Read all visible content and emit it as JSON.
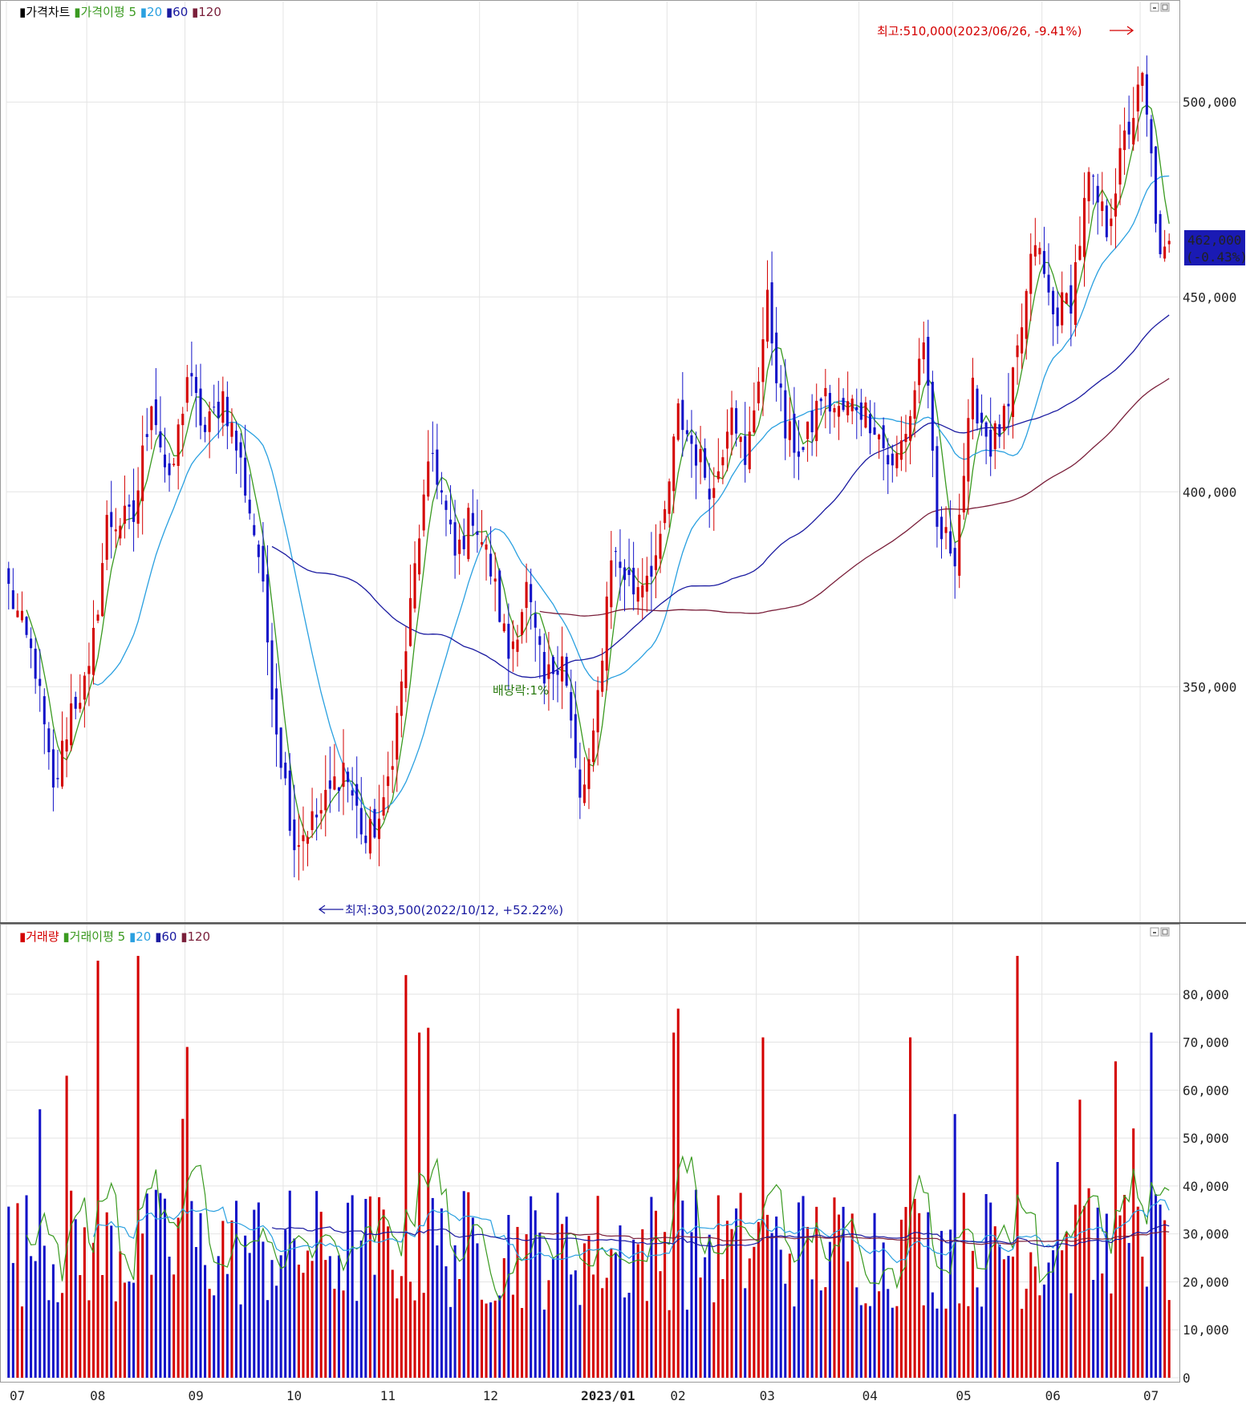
{
  "price_panel": {
    "legend": [
      {
        "text": "가격차트",
        "color": "#000000"
      },
      {
        "text": "가격이평",
        "color": "#3a9a20"
      },
      {
        "text": "5",
        "color": "#3a9a20"
      },
      {
        "text": "20",
        "color": "#2aa0e0"
      },
      {
        "text": "60",
        "color": "#1a1aa0"
      },
      {
        "text": "120",
        "color": "#7a1f3a"
      }
    ],
    "high_annotation": "최고:510,000(2023/06/26, -9.41%)",
    "low_annotation": "최저:303,500(2022/10/12, +52.22%)",
    "dividend_annotation": "배당락:1%",
    "current_price": "462,000",
    "current_change": "(-0.43%)",
    "y_ticks": [
      {
        "value": 500000,
        "label": "500,000"
      },
      {
        "value": 450000,
        "label": "450,000"
      },
      {
        "value": 400000,
        "label": "400,000"
      },
      {
        "value": 350000,
        "label": "350,000"
      }
    ]
  },
  "volume_panel": {
    "legend": [
      {
        "text": "거래량",
        "color": "#d40000"
      },
      {
        "text": "거래이평",
        "color": "#3a9a20"
      },
      {
        "text": "5",
        "color": "#3a9a20"
      },
      {
        "text": "20",
        "color": "#2aa0e0"
      },
      {
        "text": "60",
        "color": "#1a1aa0"
      },
      {
        "text": "120",
        "color": "#7a1f3a"
      }
    ],
    "y_ticks": [
      {
        "value": 80000,
        "label": "80,000"
      },
      {
        "value": 70000,
        "label": "70,000"
      },
      {
        "value": 60000,
        "label": "60,000"
      },
      {
        "value": 50000,
        "label": "50,000"
      },
      {
        "value": 40000,
        "label": "40,000"
      },
      {
        "value": 30000,
        "label": "30,000"
      },
      {
        "value": 20000,
        "label": "20,000"
      },
      {
        "value": 10000,
        "label": "10,000"
      },
      {
        "value": 0,
        "label": "0"
      }
    ]
  },
  "x_labels": [
    {
      "label": "07",
      "bold": false
    },
    {
      "label": "08",
      "bold": false
    },
    {
      "label": "09",
      "bold": false
    },
    {
      "label": "10",
      "bold": false
    },
    {
      "label": "11",
      "bold": false
    },
    {
      "label": "12",
      "bold": false
    },
    {
      "label": "2023/01",
      "bold": true
    },
    {
      "label": "02",
      "bold": false
    },
    {
      "label": "03",
      "bold": false
    },
    {
      "label": "04",
      "bold": false
    },
    {
      "label": "05",
      "bold": false
    },
    {
      "label": "06",
      "bold": false
    },
    {
      "label": "07",
      "bold": false
    }
  ],
  "colors": {
    "up": "#d40000",
    "down": "#1212c8",
    "ma5": "#3a9a20",
    "ma20": "#2aa0e0",
    "ma60": "#1a1aa0",
    "ma120": "#7a1f3a",
    "grid": "#e4e4e4",
    "current_bg": "#1a1ab4"
  },
  "chart_data": {
    "type": "candlestick",
    "price_range": [
      290000,
      520000
    ],
    "volume_range": [
      0,
      90000
    ],
    "month_starts": [
      0,
      18,
      40,
      62,
      83,
      106,
      128,
      148,
      168,
      191,
      212,
      232,
      254
    ],
    "waypoints": [
      [
        0,
        375000
      ],
      [
        6,
        355000
      ],
      [
        10,
        322000
      ],
      [
        14,
        345000
      ],
      [
        18,
        352000
      ],
      [
        22,
        392000
      ],
      [
        28,
        393000
      ],
      [
        32,
        425000
      ],
      [
        36,
        400000
      ],
      [
        40,
        430000
      ],
      [
        44,
        415000
      ],
      [
        48,
        425000
      ],
      [
        52,
        407000
      ],
      [
        56,
        384000
      ],
      [
        60,
        340000
      ],
      [
        64,
        310000
      ],
      [
        70,
        318000
      ],
      [
        75,
        330000
      ],
      [
        80,
        310000
      ],
      [
        84,
        318000
      ],
      [
        88,
        350000
      ],
      [
        92,
        390000
      ],
      [
        95,
        410000
      ],
      [
        100,
        383000
      ],
      [
        104,
        395000
      ],
      [
        108,
        380000
      ],
      [
        112,
        358000
      ],
      [
        116,
        375000
      ],
      [
        120,
        350000
      ],
      [
        124,
        360000
      ],
      [
        128,
        320000
      ],
      [
        131,
        335000
      ],
      [
        135,
        385000
      ],
      [
        140,
        375000
      ],
      [
        146,
        385000
      ],
      [
        150,
        420000
      ],
      [
        154,
        410000
      ],
      [
        158,
        400000
      ],
      [
        162,
        425000
      ],
      [
        165,
        405000
      ],
      [
        170,
        448000
      ],
      [
        174,
        415000
      ],
      [
        178,
        410000
      ],
      [
        182,
        425000
      ],
      [
        186,
        420000
      ],
      [
        190,
        423000
      ],
      [
        194,
        418000
      ],
      [
        198,
        405000
      ],
      [
        202,
        420000
      ],
      [
        205,
        440000
      ],
      [
        208,
        390000
      ],
      [
        212,
        385000
      ],
      [
        216,
        425000
      ],
      [
        220,
        412000
      ],
      [
        224,
        420000
      ],
      [
        226,
        435000
      ],
      [
        230,
        465000
      ],
      [
        234,
        445000
      ],
      [
        238,
        450000
      ],
      [
        242,
        480000
      ],
      [
        246,
        468000
      ],
      [
        250,
        490000
      ],
      [
        254,
        505000
      ],
      [
        256,
        485000
      ],
      [
        258,
        458000
      ],
      [
        260,
        462000
      ]
    ],
    "volume_spikes": [
      [
        20,
        87000
      ],
      [
        29,
        88000
      ],
      [
        40,
        69000
      ],
      [
        39,
        54000
      ],
      [
        89,
        84000
      ],
      [
        92,
        72000
      ],
      [
        94,
        73000
      ],
      [
        149,
        72000
      ],
      [
        150,
        77000
      ],
      [
        169,
        71000
      ],
      [
        202,
        71000
      ],
      [
        212,
        55000
      ],
      [
        226,
        88000
      ],
      [
        235,
        45000
      ],
      [
        240,
        58000
      ],
      [
        248,
        66000
      ],
      [
        256,
        72000
      ],
      [
        252,
        52000
      ],
      [
        13,
        63000
      ],
      [
        7,
        56000
      ]
    ],
    "ma_periods": [
      5,
      20,
      60,
      120
    ]
  }
}
